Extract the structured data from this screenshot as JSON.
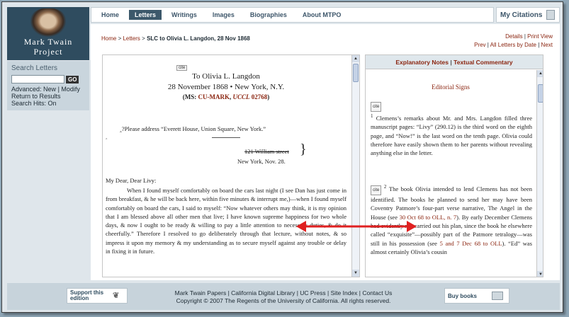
{
  "site": {
    "logo_line1": "Mark Twain",
    "logo_line2": "Project"
  },
  "search": {
    "title": "Search Letters",
    "input_value": "",
    "go_label": "GO",
    "advanced_prefix": "Advanced:",
    "new_label": "New",
    "modify_label": "Modify",
    "return_label": "Return to Results",
    "hits_label": "Search Hits: On"
  },
  "nav": {
    "items": [
      {
        "label": "Home"
      },
      {
        "label": "Letters"
      },
      {
        "label": "Writings"
      },
      {
        "label": "Images"
      },
      {
        "label": "Biographies"
      },
      {
        "label": "About MTPO"
      }
    ],
    "my_citations": "My Citations"
  },
  "breadcrumb": {
    "home": "Home",
    "letters": "Letters",
    "current": "SLC to Olivia L. Langdon, 28 Nov 1868"
  },
  "toplinks": {
    "details": "Details",
    "print": "Print View",
    "prev": "Prev",
    "all_by_date": "All Letters by Date",
    "next": "Next"
  },
  "letter": {
    "cite": "cite",
    "title_line1": "To Olivia L. Langdon",
    "title_line2": "28 November 1868 • New York, N.Y.",
    "ms_prefix": "(MS: ",
    "ms_mark": "CU-MARK",
    "ms_uccl": "UCCL",
    "ms_num": "02768",
    "ms_suffix": ")",
    "address_note": "‸?Please address “Everett House, Union Square, New York.”",
    "caret": "‸",
    "street": "121 William street",
    "brace": "}",
    "city_date": "New York, Nov. 28.",
    "salutation": "My Dear, Dear Livy:",
    "body": "When I found myself comfortably on board the cars last night (I see Dan has just come in from breakfast, & he will be back here, within five minutes & interrupt me,)—when I found myself comfortably on board the cars, I said to myself: “Now whatever others may think, it is my opinion that I am blessed above all other men that live; I have known supreme happiness for two whole days, & now I ought to be ready & willing to pay a little attention to necessary duties, & do it cheerfully.” Therefore I resolved to go deliberately through that lecture, without notes, & so impress it upon my memory & my understanding as to secure myself against any trouble or delay in fixing it in future."
  },
  "notes": {
    "tab_explanatory": "Explanatory Notes",
    "tab_textual": "Textual Commentary",
    "heading": "Editorial Signs",
    "cite": "cite",
    "note1_num": "1",
    "note1": "Clemens’s remarks about Mr. and Mrs. Langdon filled three manuscript pages: “Livy” (290.12) is the third word on the eighth page, and “Now!” is the last word on the tenth page. Olivia could therefore have easily shown them to her parents without revealing anything else in the letter.",
    "note2_num": "2",
    "note2_a": "The book Olivia intended to lend Clemens has not been identified. The books he planned to send her may have been Coventry Patmore’s four-part verse narrative, The Angel in the House (see ",
    "note2_link1": "30 Oct 68 to OLL, n. 7",
    "note2_b": "). By early December Clemens had evidently not carried out his plan, since the book he elsewhere called “exquisite”—possibly part of the Patmore tetralogy—was still in his possession (see ",
    "note2_link2": "5 and 7 Dec 68 to OLL",
    "note2_c": "). “Ed” was almost certainly Olivia’s cousin"
  },
  "footer": {
    "support": "Support this edition",
    "links_line1": "Mark Twain Papers | California Digital Library | UC Press | Site Index | Contact Us",
    "links_line2": "Copyright © 2007 The Regents of the University of California. All rights reserved.",
    "buy_books": "Buy books"
  },
  "colors": {
    "accent_red": "#8b2510",
    "nav_active": "#3c586b",
    "annotation_arrow": "#e02020"
  }
}
